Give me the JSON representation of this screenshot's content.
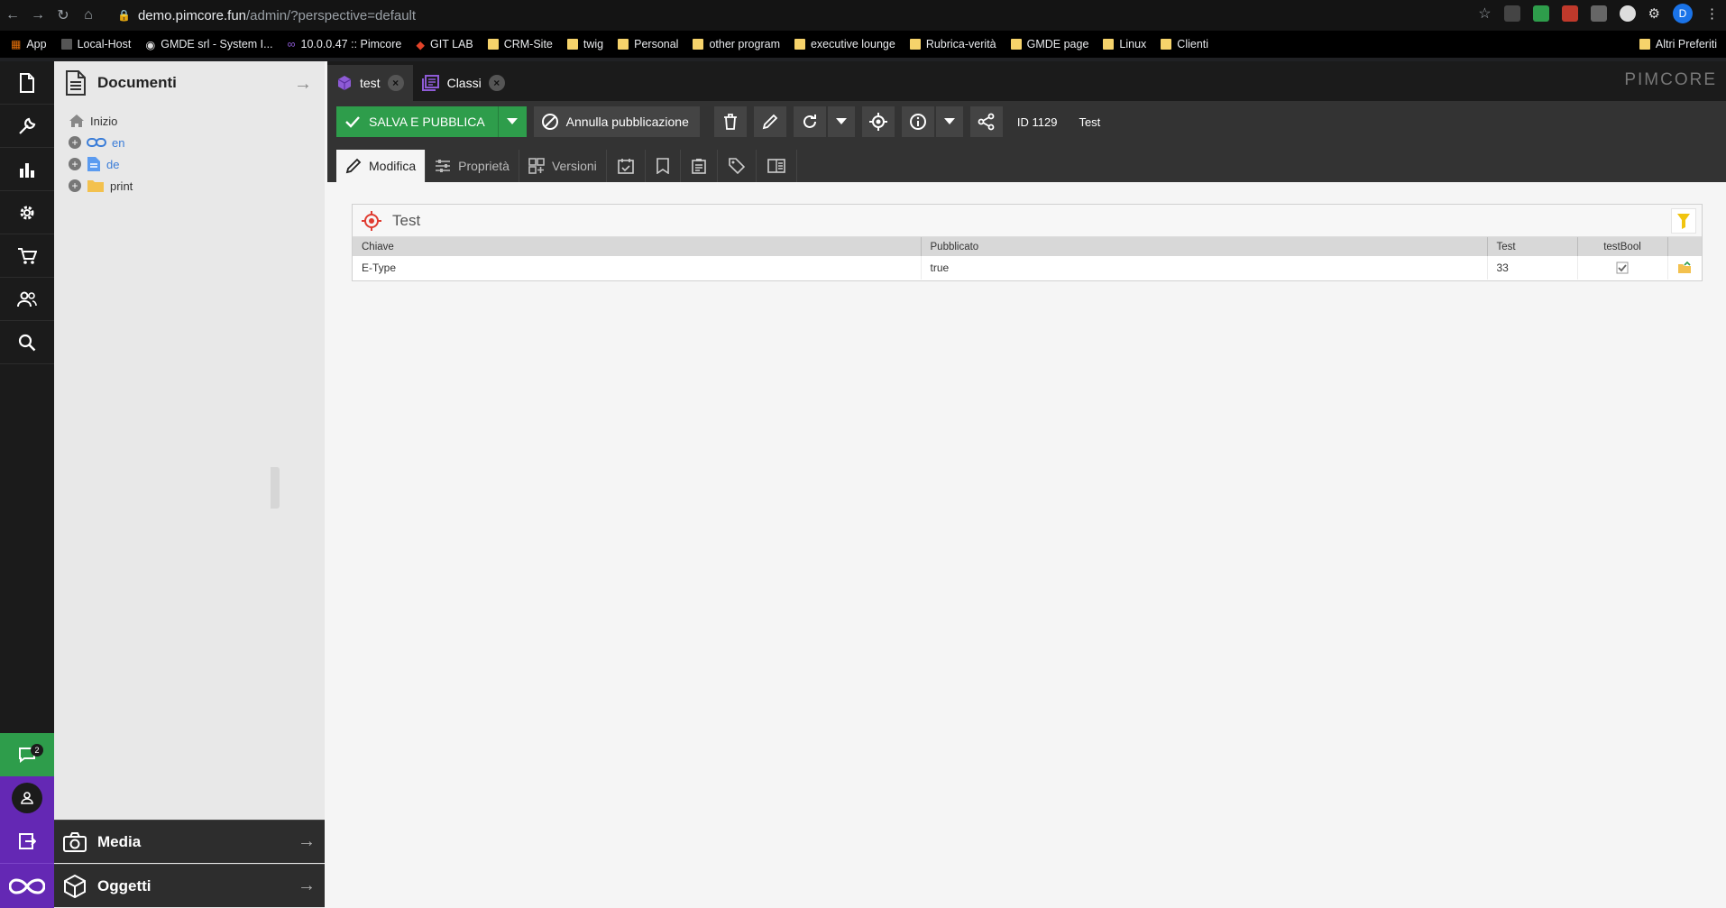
{
  "browser": {
    "url_host": "demo.pimcore.fun",
    "url_path": "/admin/?perspective=default",
    "profile_initial": "D",
    "bookmarks": [
      "App",
      "Local-Host",
      "GMDE srl - System I...",
      "10.0.0.47 :: Pimcore",
      "GIT LAB",
      "CRM-Site",
      "twig",
      "Personal",
      "other program",
      "executive lounge",
      "Rubrica-verità",
      "GMDE page",
      "Linux",
      "Clienti"
    ],
    "other_bookmarks": "Altri Preferiti"
  },
  "sidebar": {
    "chat_badge": "2",
    "icons": [
      "document-icon",
      "wrench-icon",
      "chart-icon",
      "gear-icon",
      "cart-icon",
      "users-icon",
      "search-icon"
    ]
  },
  "tree": {
    "title": "Documenti",
    "home": "Inizio",
    "nodes": [
      {
        "label": "en",
        "type": "link"
      },
      {
        "label": "de",
        "type": "page"
      },
      {
        "label": "print",
        "type": "folder"
      }
    ]
  },
  "accordion": {
    "media": "Media",
    "objects": "Oggetti"
  },
  "tabs": [
    {
      "label": "test",
      "active": true
    },
    {
      "label": "Classi",
      "active": false
    }
  ],
  "brand": "PIMCORE",
  "toolbar": {
    "save_publish": "SALVA E PUBBLICA",
    "unpublish": "Annulla pubblicazione",
    "id_label": "ID 1129",
    "name": "Test"
  },
  "subtabs": {
    "edit": "Modifica",
    "properties": "Proprietà",
    "versions": "Versioni"
  },
  "panel": {
    "title": "Test",
    "columns": [
      "Chiave",
      "Pubblicato",
      "Test",
      "testBool",
      ""
    ],
    "rows": [
      {
        "key": "E-Type",
        "published": "true",
        "test": "33",
        "testBool": true
      }
    ]
  },
  "colors": {
    "accent_green": "#2e9d4b",
    "accent_purple": "#6428b4"
  }
}
